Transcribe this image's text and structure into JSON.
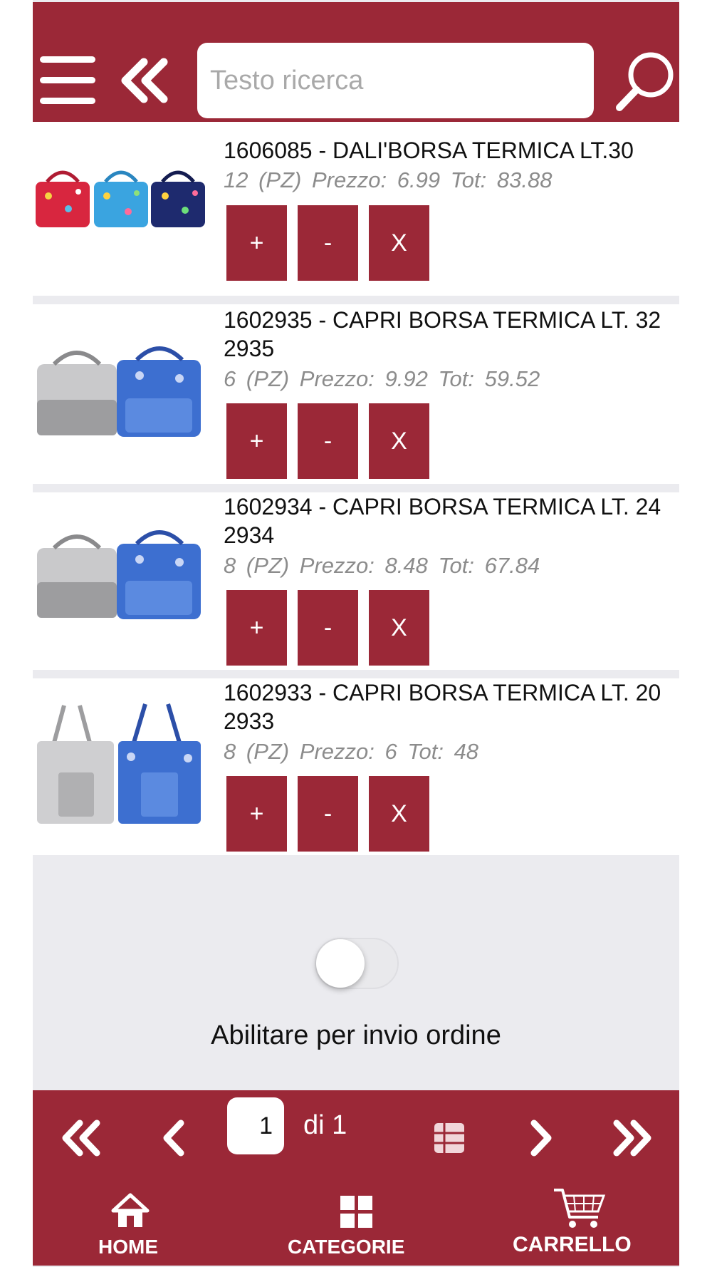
{
  "header": {
    "search_placeholder": "Testo ricerca",
    "menu_icon": "hamburger-icon",
    "back_icon": "double-chevron-left-icon",
    "search_icon": "magnifier-icon"
  },
  "colors": {
    "brand": "#9b2837",
    "background": "#ebebef",
    "muted_text": "#8c8c8c"
  },
  "items": [
    {
      "title": "1606085 - DALI'BORSA TERMICA LT.30",
      "qty": "12",
      "unit": "(PZ)",
      "price_label": "Prezzo:",
      "price": "6.99",
      "tot_label": "Tot:",
      "tot": "83.88",
      "plus": "+",
      "minus": "-",
      "remove": "X"
    },
    {
      "title": "1602935 - CAPRI BORSA TERMICA LT. 32 2935",
      "qty": "6",
      "unit": "(PZ)",
      "price_label": "Prezzo:",
      "price": "9.92",
      "tot_label": "Tot:",
      "tot": "59.52",
      "plus": "+",
      "minus": "-",
      "remove": "X"
    },
    {
      "title": "1602934 - CAPRI BORSA TERMICA LT. 24 2934",
      "qty": "8",
      "unit": "(PZ)",
      "price_label": "Prezzo:",
      "price": "8.48",
      "tot_label": "Tot:",
      "tot": "67.84",
      "plus": "+",
      "minus": "-",
      "remove": "X"
    },
    {
      "title": "1602933 - CAPRI BORSA TERMICA LT. 20 2933",
      "qty": "8",
      "unit": "(PZ)",
      "price_label": "Prezzo:",
      "price": "6",
      "tot_label": "Tot:",
      "tot": "48",
      "plus": "+",
      "minus": "-",
      "remove": "X"
    }
  ],
  "order_toggle": {
    "label": "Abilitare per invio ordine",
    "enabled": false
  },
  "pagination": {
    "current_page": "1",
    "of_label": "di 1"
  },
  "tabs": [
    {
      "label": "HOME",
      "icon": "home-icon"
    },
    {
      "label": "CATEGORIE",
      "icon": "grid-icon"
    },
    {
      "label": "CARRELLO",
      "icon": "cart-icon"
    }
  ]
}
